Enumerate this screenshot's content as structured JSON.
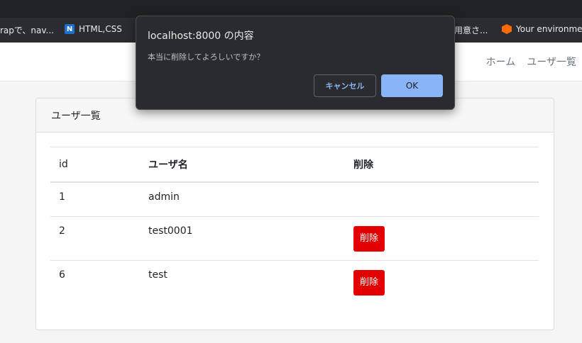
{
  "bookmarks": [
    {
      "label": "rapで、nav..."
    },
    {
      "label": "HTML,CSS",
      "icon": "notion-n-icon"
    },
    {
      "label": "用意さ..."
    },
    {
      "label": "Your environment",
      "icon": "orange-hex-icon"
    }
  ],
  "nav": {
    "home": "ホーム",
    "users": "ユーザ一覧"
  },
  "card": {
    "title": "ユーザ一覧"
  },
  "table": {
    "headers": [
      "id",
      "ユーザ名",
      "削除"
    ],
    "rows": [
      {
        "id": "1",
        "name": "admin",
        "delete": ""
      },
      {
        "id": "2",
        "name": "test0001",
        "delete": "削除"
      },
      {
        "id": "6",
        "name": "test",
        "delete": "削除"
      }
    ]
  },
  "dialog": {
    "title": "localhost:8000 の内容",
    "message": "本当に削除してよろしいですか？",
    "cancel": "キャンセル",
    "ok": "OK"
  },
  "colors": {
    "danger": "#e30000",
    "accent": "#8ab4f8"
  }
}
